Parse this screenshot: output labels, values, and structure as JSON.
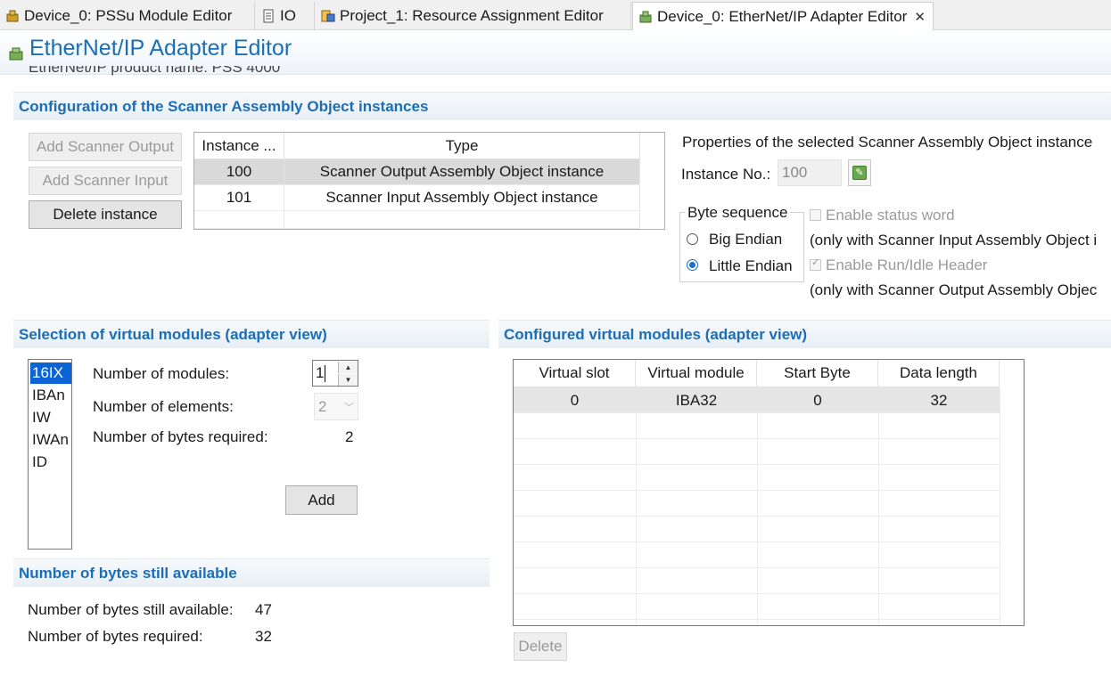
{
  "tabs": [
    {
      "label": "Device_0: PSSu Module Editor",
      "icon": "device-icon"
    },
    {
      "label": "IO",
      "icon": "document-icon"
    },
    {
      "label": "Project_1: Resource Assignment Editor",
      "icon": "resource-icon"
    },
    {
      "label": "Device_0: EtherNet/IP Adapter Editor",
      "icon": "device-icon",
      "active": true
    }
  ],
  "header": {
    "title": "EtherNet/IP Adapter Editor",
    "clipped_text": "EtherNet/IP product name: PSS 4000"
  },
  "scanner_section": {
    "title": "Configuration of the Scanner Assembly Object instances",
    "add_output_label": "Add Scanner Output",
    "add_input_label": "Add Scanner Input",
    "delete_label": "Delete instance",
    "table": {
      "columns": [
        "Instance ...",
        "Type"
      ],
      "rows": [
        {
          "instance": "100",
          "type": "Scanner Output Assembly Object instance",
          "selected": true
        },
        {
          "instance": "101",
          "type": "Scanner Input Assembly Object instance",
          "selected": false
        }
      ]
    },
    "properties": {
      "title": "Properties of the selected Scanner Assembly Object instance",
      "instance_no_label": "Instance No.:",
      "instance_no_value": "100",
      "byte_sequence_label": "Byte sequence",
      "big_endian_label": "Big Endian",
      "little_endian_label": "Little Endian",
      "selected_byte_order": "Little Endian",
      "enable_status_word_label": "Enable status word",
      "status_word_note": "(only with Scanner Input Assembly Object i",
      "enable_run_idle_label": "Enable Run/Idle Header",
      "run_idle_note": "(only with Scanner Output Assembly Objec"
    }
  },
  "selection_section": {
    "title": "Selection of virtual modules (adapter view)",
    "modules": [
      "16IX",
      "IBAn",
      "IW",
      "IWAn",
      "ID"
    ],
    "selected_module": "16IX",
    "num_modules_label": "Number of modules:",
    "num_modules_value": "1",
    "num_elements_label": "Number of elements:",
    "num_elements_value": "2",
    "bytes_required_label": "Number of bytes required:",
    "bytes_required_value": "2",
    "add_label": "Add"
  },
  "bytes_section": {
    "title": "Number of bytes still available",
    "available_label": "Number of bytes still available:",
    "available_value": "47",
    "required_label": "Number of bytes required:",
    "required_value": "32"
  },
  "configured_section": {
    "title": "Configured virtual modules (adapter view)",
    "columns": [
      "Virtual slot",
      "Virtual module",
      "Start Byte",
      "Data length"
    ],
    "rows": [
      {
        "slot": "0",
        "module": "IBA32",
        "start_byte": "0",
        "length": "32"
      }
    ],
    "delete_label": "Delete"
  },
  "colors": {
    "accent": "#1d6db5",
    "selection": "#0a64d6",
    "row_selected": "#d9d9d9"
  }
}
